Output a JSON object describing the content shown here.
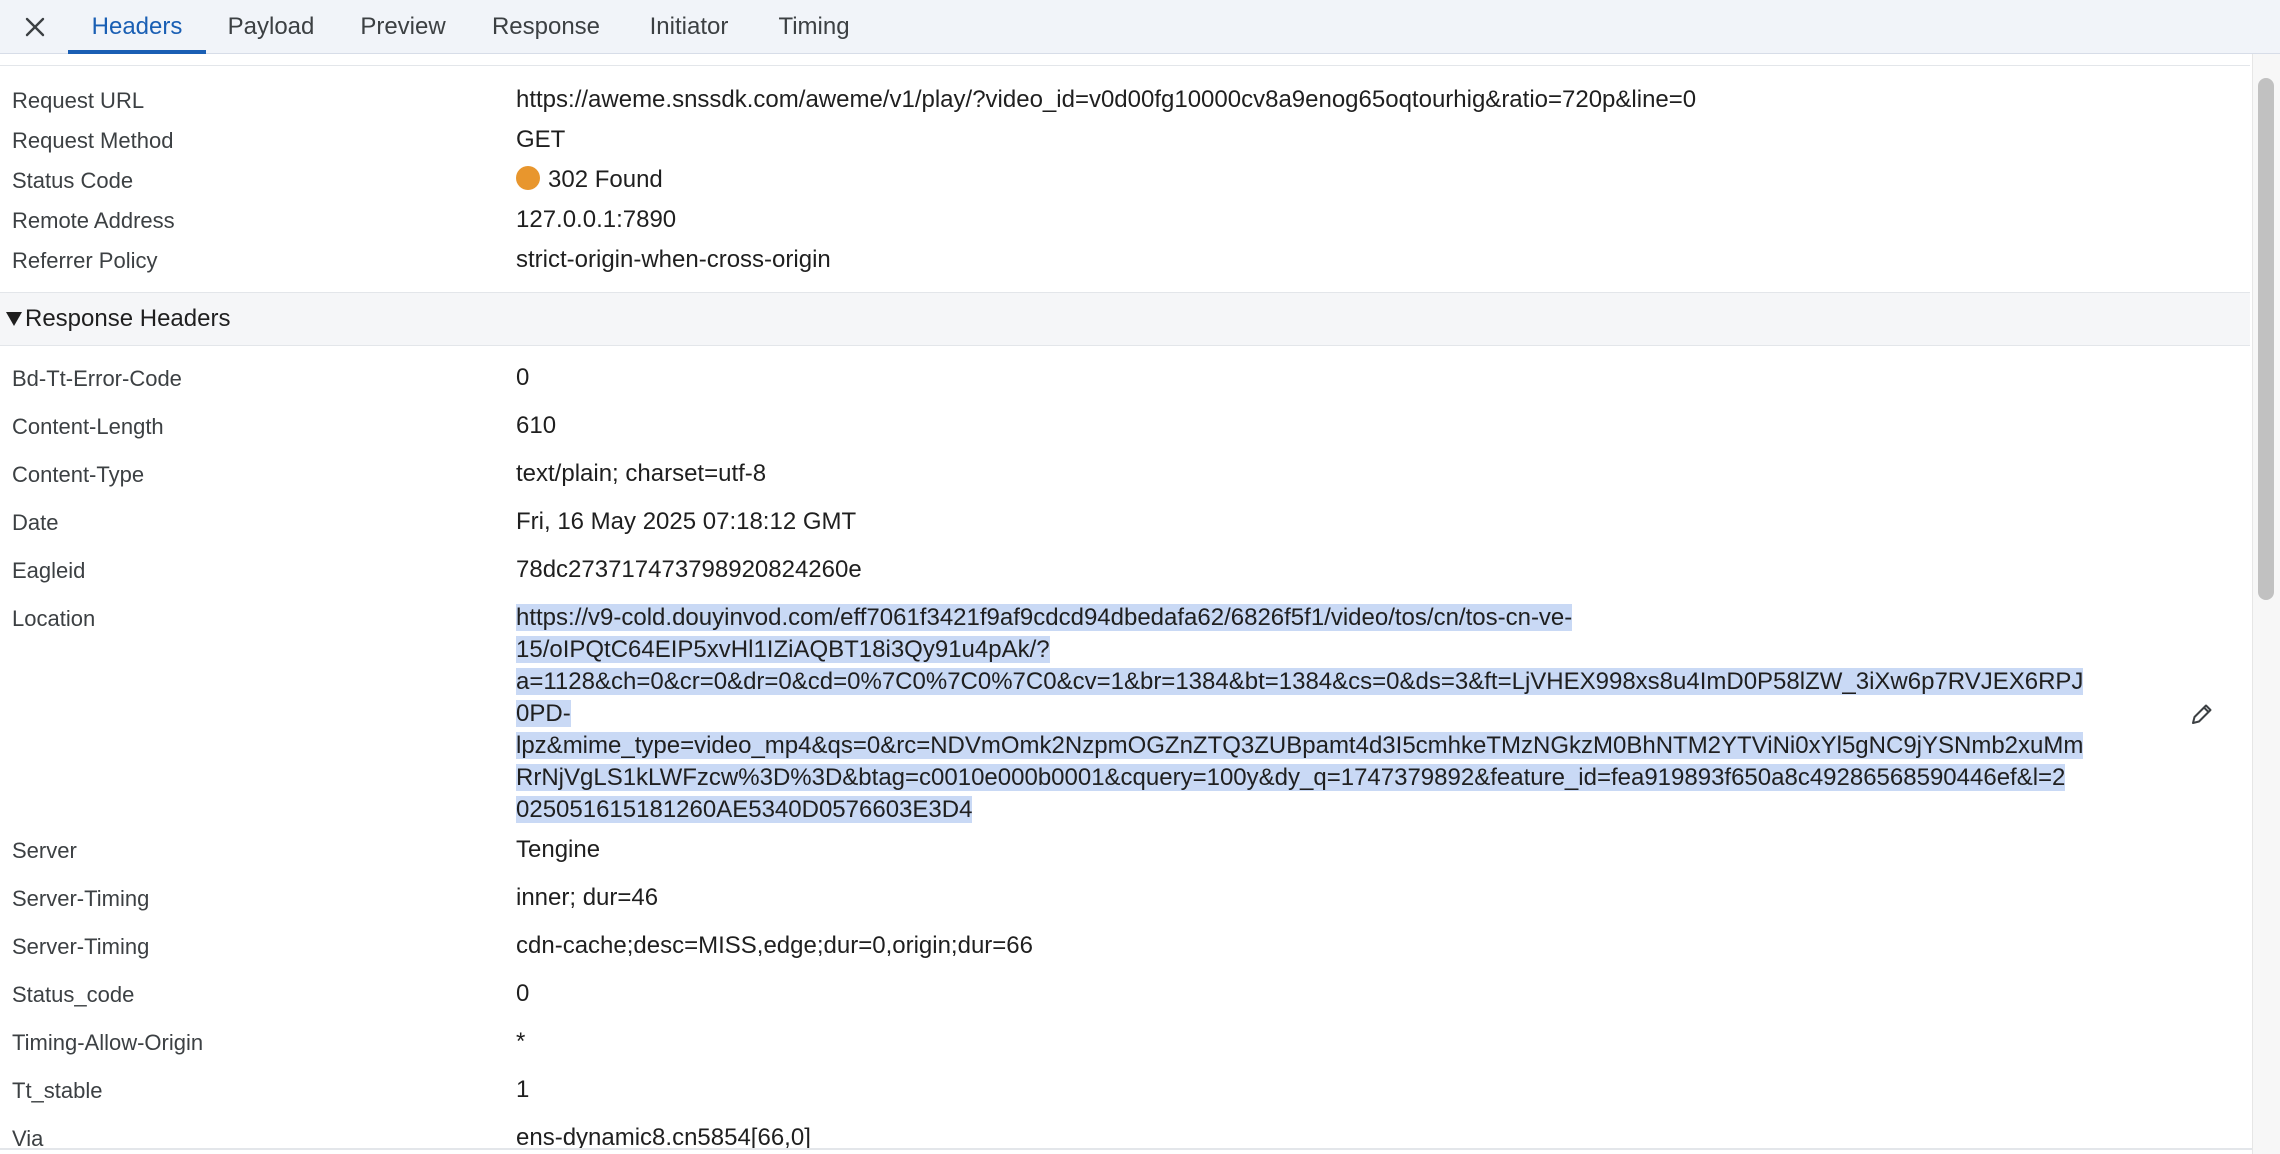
{
  "tabs": [
    {
      "label": "Headers",
      "active": true
    },
    {
      "label": "Payload",
      "active": false
    },
    {
      "label": "Preview",
      "active": false
    },
    {
      "label": "Response",
      "active": false
    },
    {
      "label": "Initiator",
      "active": false
    },
    {
      "label": "Timing",
      "active": false
    }
  ],
  "general": {
    "request_url": {
      "label": "Request URL",
      "value": "https://aweme.snssdk.com/aweme/v1/play/?video_id=v0d00fg10000cv8a9enog65oqtourhig&ratio=720p&line=0"
    },
    "request_method": {
      "label": "Request Method",
      "value": "GET"
    },
    "status_code": {
      "label": "Status Code",
      "value": "302 Found",
      "dot_color": "#e8962d"
    },
    "remote_address": {
      "label": "Remote Address",
      "value": "127.0.0.1:7890"
    },
    "referrer_policy": {
      "label": "Referrer Policy",
      "value": "strict-origin-when-cross-origin"
    }
  },
  "response_headers": {
    "title": "Response Headers",
    "rows": [
      {
        "name": "Bd-Tt-Error-Code",
        "value": "0"
      },
      {
        "name": "Content-Length",
        "value": "610"
      },
      {
        "name": "Content-Type",
        "value": "text/plain; charset=utf-8"
      },
      {
        "name": "Date",
        "value": "Fri, 16 May 2025 07:18:12 GMT"
      },
      {
        "name": "Eagleid",
        "value": "78dc273717473798920824260e"
      }
    ],
    "location": {
      "name": "Location",
      "lines": [
        "https://v9-cold.douyinvod.com/eff7061f3421f9af9cdcd94dbedafa62/6826f5f1/video/tos/cn/tos-cn-ve-",
        "15/oIPQtC64EIP5xvHl1IZiAQBT18i3Qy91u4pAk/?",
        "a=1128&ch=0&cr=0&dr=0&cd=0%7C0%7C0%7C0&cv=1&br=1384&bt=1384&cs=0&ds=3&ft=LjVHEX998xs8u4ImD0P58lZW_3iXw6p7RVJEX6RPJ",
        "0PD-",
        "lpz&mime_type=video_mp4&qs=0&rc=NDVmOmk2NzpmOGZnZTQ3ZUBpamt4d3I5cmhkeTMzNGkzM0BhNTM2YTViNi0xYl5gNC9jYSNmb2xuMm",
        "RrNjVgLS1kLWFzcw%3D%3D&btag=c0010e000b0001&cquery=100y&dy_q=1747379892&feature_id=fea919893f650a8c49286568590446ef&l=2",
        "025051615181260AE5340D0576603E3D4"
      ]
    },
    "rows_after": [
      {
        "name": "Server",
        "value": "Tengine"
      },
      {
        "name": "Server-Timing",
        "value": "inner; dur=46"
      },
      {
        "name": "Server-Timing",
        "value": "cdn-cache;desc=MISS,edge;dur=0,origin;dur=66"
      },
      {
        "name": "Status_code",
        "value": "0"
      },
      {
        "name": "Timing-Allow-Origin",
        "value": "*"
      },
      {
        "name": "Tt_stable",
        "value": "1"
      },
      {
        "name": "Via",
        "value": "ens-dynamic8.cn5854[66,0]"
      }
    ]
  },
  "colors": {
    "accent": "#1a5fb4",
    "selection": "#c9d9f5",
    "status_warning": "#e8962d"
  },
  "icons": {
    "close": "close-icon",
    "edit": "pencil-icon",
    "expand": "triangle-down-icon"
  }
}
